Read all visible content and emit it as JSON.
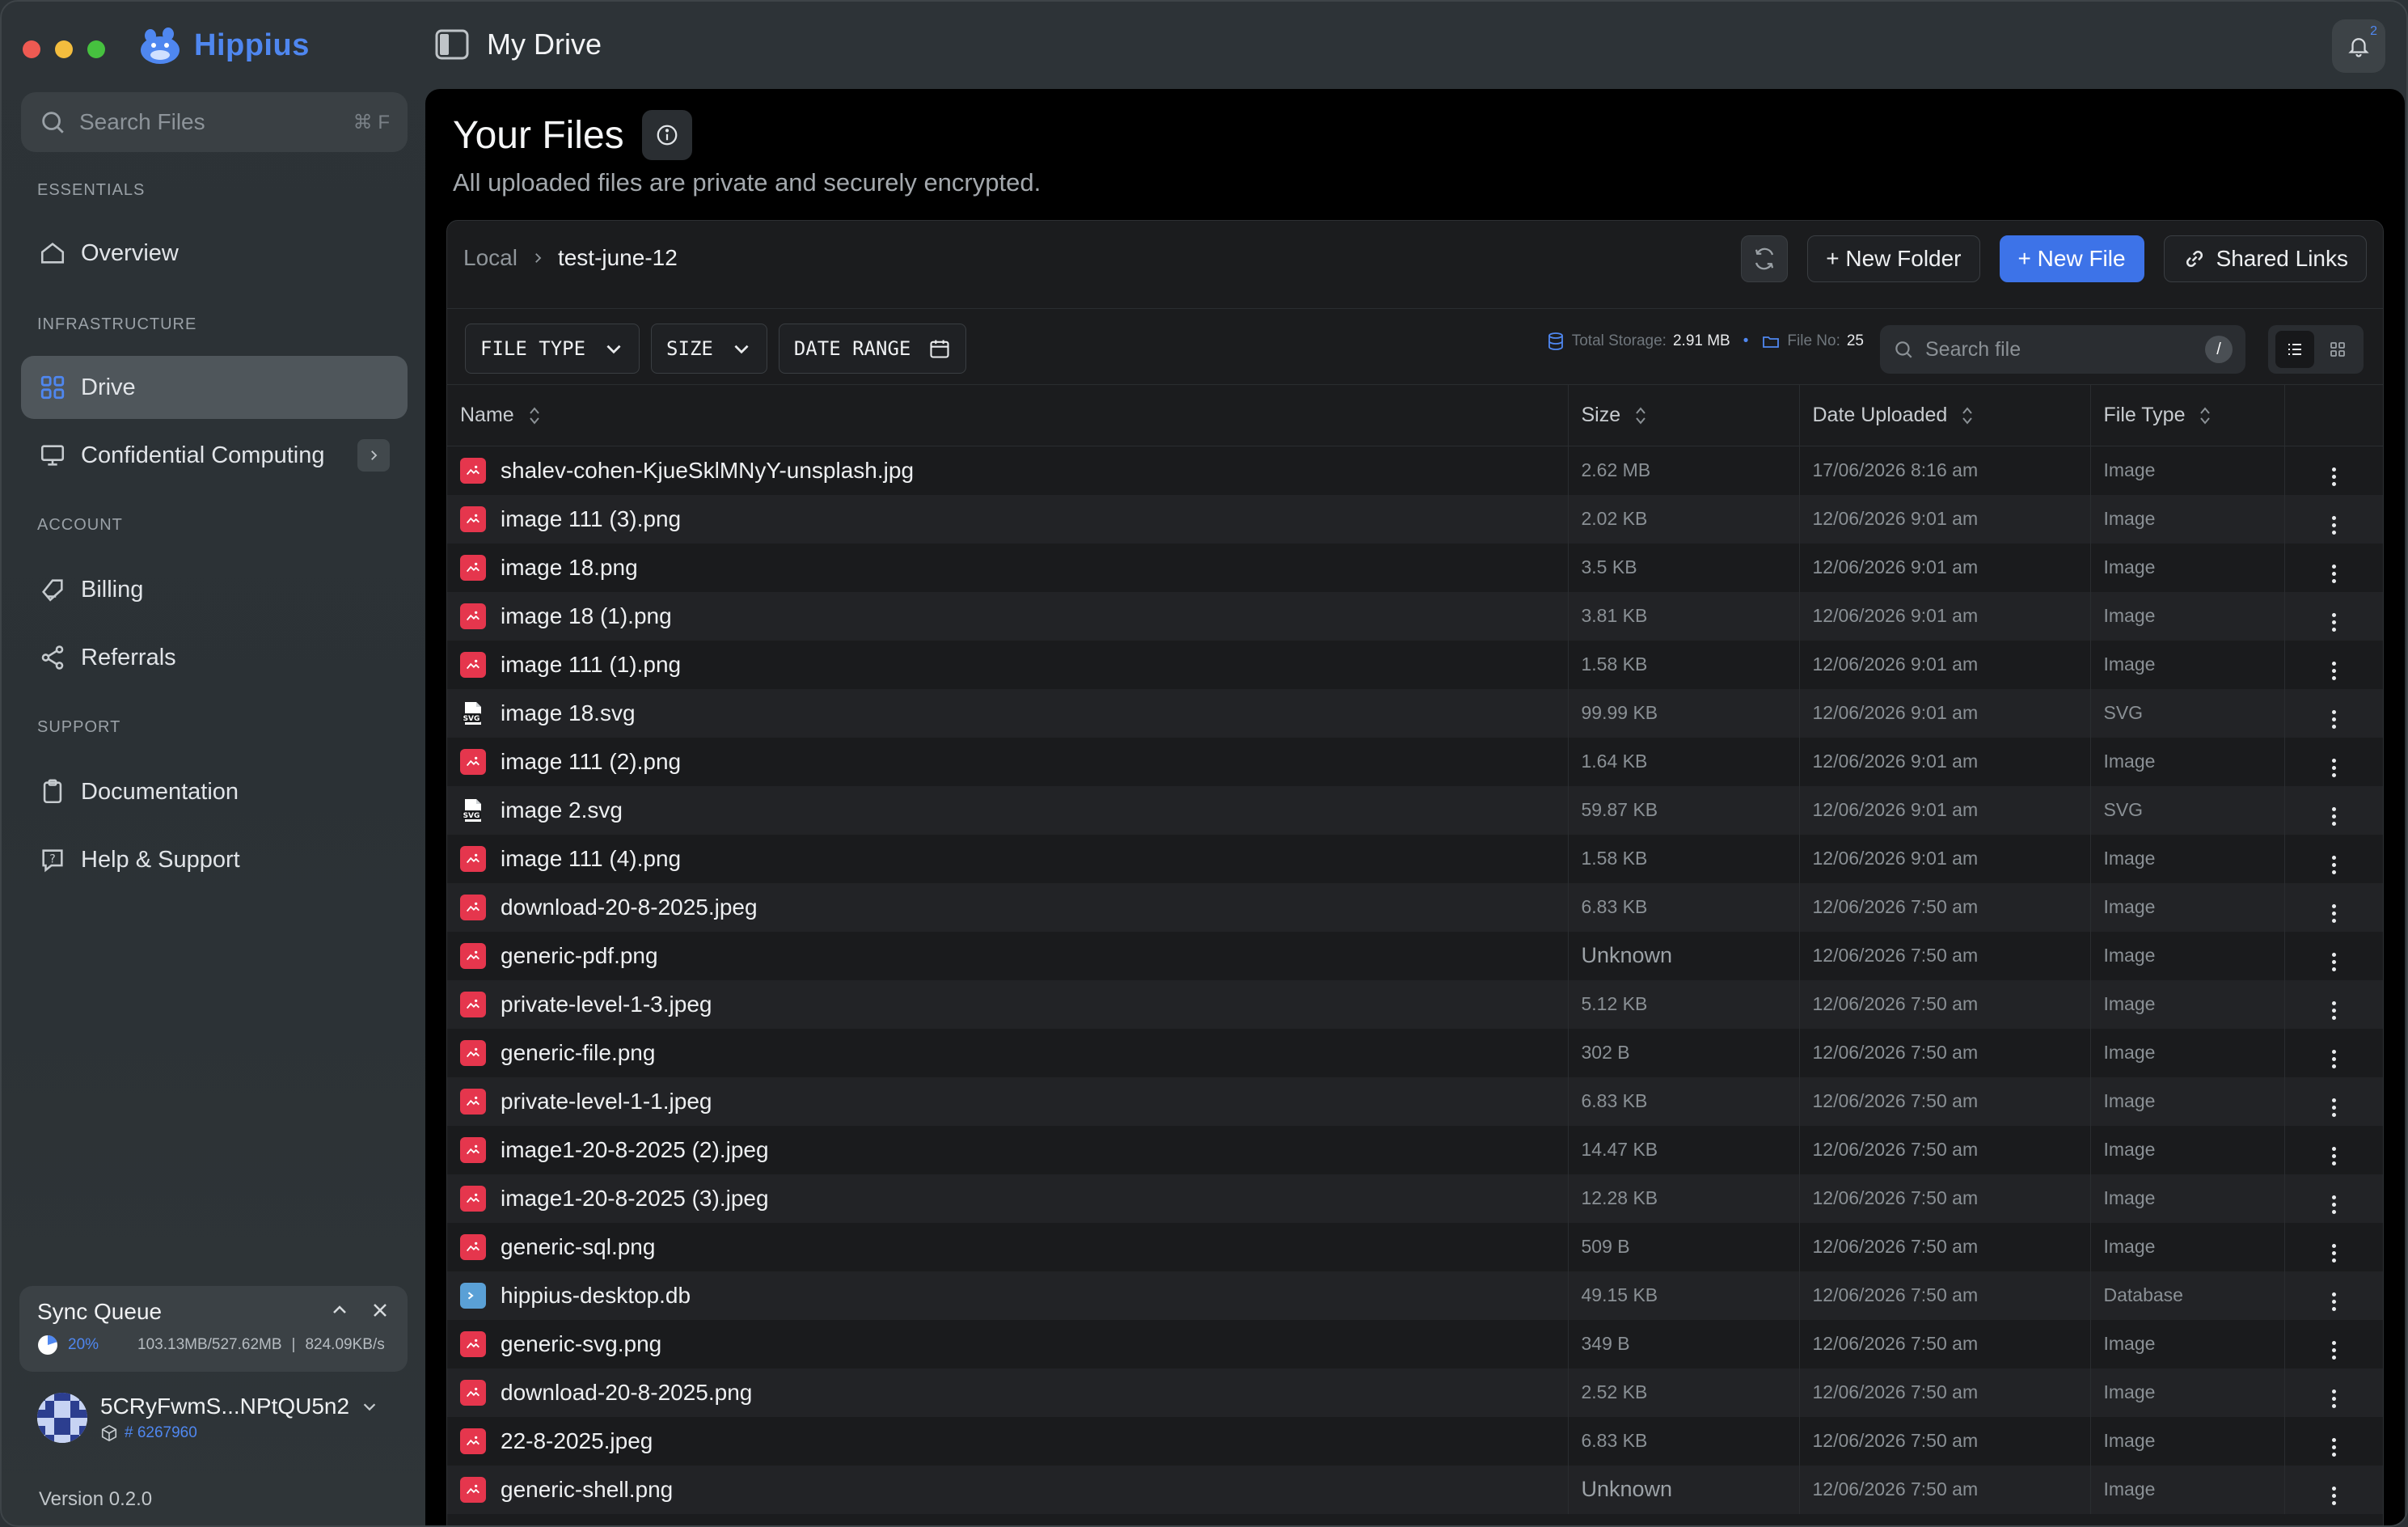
{
  "app": {
    "name": "Hippius",
    "page_title": "My Drive",
    "notifications_count": "2"
  },
  "colors": {
    "accent": "#3d73e8",
    "brand": "#4f87f0",
    "file_image": "#e5364d",
    "file_db": "#5aa0d6"
  },
  "sidebar": {
    "search": {
      "placeholder": "Search Files",
      "shortcut": "⌘ F"
    },
    "sections": {
      "essentials": "ESSENTIALS",
      "infrastructure": "INFRASTRUCTURE",
      "account": "ACCOUNT",
      "support": "SUPPORT"
    },
    "items": {
      "overview": "Overview",
      "drive": "Drive",
      "confidential": "Confidential Computing",
      "billing": "Billing",
      "referrals": "Referrals",
      "documentation": "Documentation",
      "help": "Help & Support"
    },
    "sync": {
      "title": "Sync Queue",
      "percent": "20%",
      "percent_value": 20,
      "transfer": "103.13MB/527.62MB",
      "speed": "824.09KB/s"
    },
    "user": {
      "name": "5CRyFwmS...NPtQU5n2",
      "id": "# 6267960"
    },
    "version": "Version 0.2.0"
  },
  "main": {
    "title": "Your Files",
    "subtitle": "All uploaded files are private and securely encrypted.",
    "breadcrumb": [
      "Local",
      "test-june-12"
    ],
    "buttons": {
      "new_folder": "+ New Folder",
      "new_file": "+ New File",
      "shared_links": "Shared Links"
    },
    "filters": {
      "file_type": "FILE TYPE",
      "size": "SIZE",
      "date_range": "DATE RANGE"
    },
    "stats": {
      "storage_label": "Total Storage:",
      "storage_value": "2.91 MB",
      "count_label": "File No:",
      "count_value": "25"
    },
    "search_placeholder": "Search file",
    "search_shortcut": "/",
    "columns": {
      "name": "Name",
      "size": "Size",
      "date": "Date Uploaded",
      "type": "File Type"
    },
    "files": [
      {
        "name": "shalev-cohen-KjueSklMNyY-unsplash.jpg",
        "size": "2.62 MB",
        "date": "17/06/2026 8:16 am",
        "type": "Image",
        "icon": "image"
      },
      {
        "name": "image 111 (3).png",
        "size": "2.02 KB",
        "date": "12/06/2026 9:01 am",
        "type": "Image",
        "icon": "image"
      },
      {
        "name": "image 18.png",
        "size": "3.5 KB",
        "date": "12/06/2026 9:01 am",
        "type": "Image",
        "icon": "image"
      },
      {
        "name": "image 18 (1).png",
        "size": "3.81 KB",
        "date": "12/06/2026 9:01 am",
        "type": "Image",
        "icon": "image"
      },
      {
        "name": "image 111 (1).png",
        "size": "1.58 KB",
        "date": "12/06/2026 9:01 am",
        "type": "Image",
        "icon": "image"
      },
      {
        "name": "image 18.svg",
        "size": "99.99 KB",
        "date": "12/06/2026 9:01 am",
        "type": "SVG",
        "icon": "svg"
      },
      {
        "name": "image 111 (2).png",
        "size": "1.64 KB",
        "date": "12/06/2026 9:01 am",
        "type": "Image",
        "icon": "image"
      },
      {
        "name": "image 2.svg",
        "size": "59.87 KB",
        "date": "12/06/2026 9:01 am",
        "type": "SVG",
        "icon": "svg"
      },
      {
        "name": "image 111 (4).png",
        "size": "1.58 KB",
        "date": "12/06/2026 9:01 am",
        "type": "Image",
        "icon": "image"
      },
      {
        "name": "download-20-8-2025.jpeg",
        "size": "6.83 KB",
        "date": "12/06/2026 7:50 am",
        "type": "Image",
        "icon": "image"
      },
      {
        "name": "generic-pdf.png",
        "size": "Unknown",
        "date": "12/06/2026 7:50 am",
        "type": "Image",
        "icon": "image"
      },
      {
        "name": "private-level-1-3.jpeg",
        "size": "5.12 KB",
        "date": "12/06/2026 7:50 am",
        "type": "Image",
        "icon": "image"
      },
      {
        "name": "generic-file.png",
        "size": "302 B",
        "date": "12/06/2026 7:50 am",
        "type": "Image",
        "icon": "image"
      },
      {
        "name": "private-level-1-1.jpeg",
        "size": "6.83 KB",
        "date": "12/06/2026 7:50 am",
        "type": "Image",
        "icon": "image"
      },
      {
        "name": "image1-20-8-2025 (2).jpeg",
        "size": "14.47 KB",
        "date": "12/06/2026 7:50 am",
        "type": "Image",
        "icon": "image"
      },
      {
        "name": "image1-20-8-2025 (3).jpeg",
        "size": "12.28 KB",
        "date": "12/06/2026 7:50 am",
        "type": "Image",
        "icon": "image"
      },
      {
        "name": "generic-sql.png",
        "size": "509 B",
        "date": "12/06/2026 7:50 am",
        "type": "Image",
        "icon": "image"
      },
      {
        "name": "hippius-desktop.db",
        "size": "49.15 KB",
        "date": "12/06/2026 7:50 am",
        "type": "Database",
        "icon": "db"
      },
      {
        "name": "generic-svg.png",
        "size": "349 B",
        "date": "12/06/2026 7:50 am",
        "type": "Image",
        "icon": "image"
      },
      {
        "name": "download-20-8-2025.png",
        "size": "2.52 KB",
        "date": "12/06/2026 7:50 am",
        "type": "Image",
        "icon": "image"
      },
      {
        "name": "22-8-2025.jpeg",
        "size": "6.83 KB",
        "date": "12/06/2026 7:50 am",
        "type": "Image",
        "icon": "image"
      },
      {
        "name": "generic-shell.png",
        "size": "Unknown",
        "date": "12/06/2026 7:50 am",
        "type": "Image",
        "icon": "image"
      }
    ]
  }
}
